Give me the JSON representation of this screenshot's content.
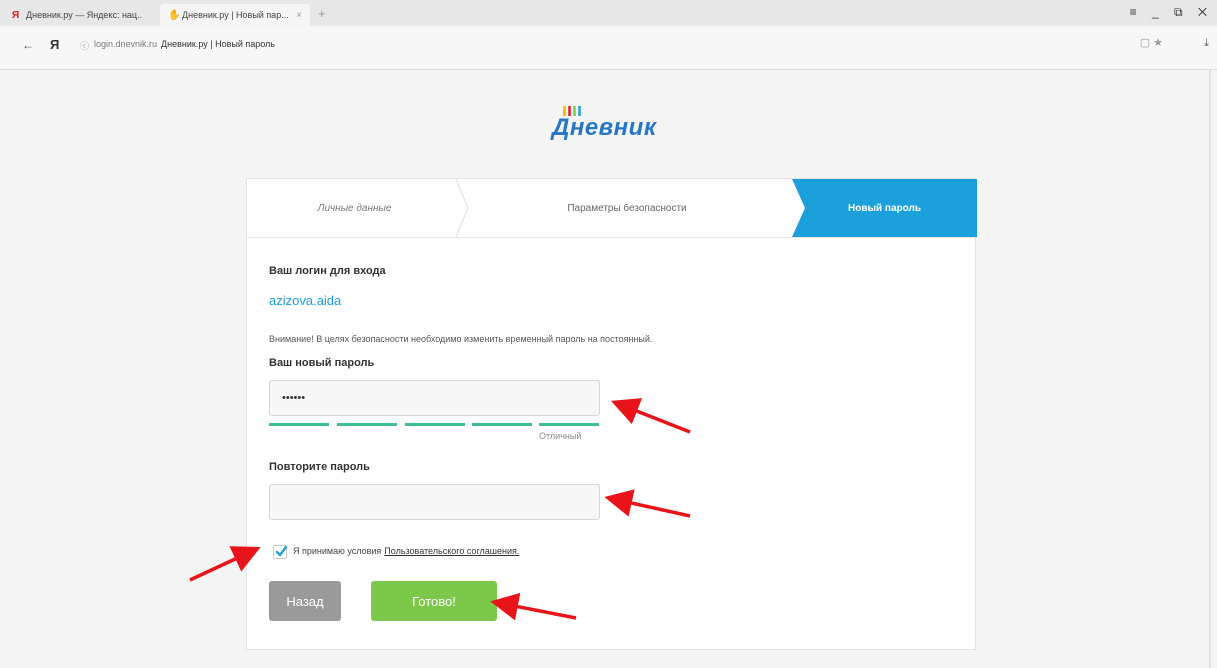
{
  "browser": {
    "tabs": [
      {
        "favicon": "Я",
        "title": "Дневник.ру — Яндекс: нац.."
      },
      {
        "favicon": "✋",
        "title": "Дневник.ру | Новый пар..."
      }
    ],
    "new_tab": "+",
    "window_controls": "≡ _ ⧉ ✕",
    "back": "←",
    "yandex_button": "Я",
    "lock": "ⓒ",
    "url_host": "login.dnevnik.ru",
    "url_title": "Дневник.ру | Новый пароль",
    "addr_icons": "▢ ★",
    "download_icon": "⤓"
  },
  "logo": {
    "text": "Дневник"
  },
  "steps": [
    {
      "label": "Личные данные"
    },
    {
      "label": "Параметры безопасности"
    },
    {
      "label": "Новый пароль"
    }
  ],
  "form": {
    "login_label": "Ваш логин для входа",
    "login_value": "azizova.aida",
    "notice": "Внимание! В целях безопасности необходимо изменить временный пароль на постоянный.",
    "new_password_label": "Ваш новый пароль",
    "new_password_value": "••••••",
    "strength_segments": 5,
    "strength_label": "Отличный",
    "repeat_password_label": "Повторите пароль",
    "repeat_password_value": "",
    "agree_text": "Я принимаю условия",
    "agree_link": "Пользовательского соглашения.",
    "agree_checked": true,
    "back_button": "Назад",
    "done_button": "Готово!"
  },
  "colors": {
    "accent": "#1ca0dc",
    "strength": "#3bbf8f",
    "done": "#7cc84a",
    "back": "#9a9a9a",
    "arrow": "#e8141a"
  }
}
